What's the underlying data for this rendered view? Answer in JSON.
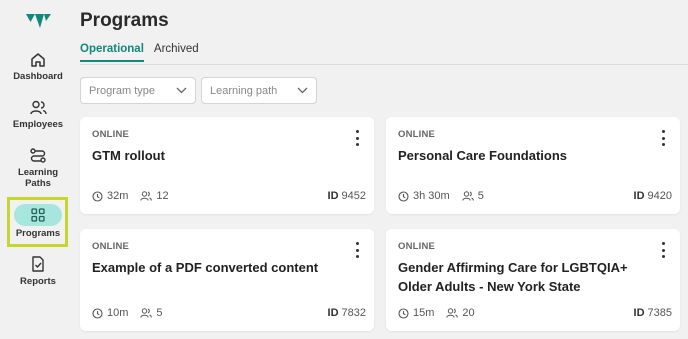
{
  "sidebar": {
    "items": [
      {
        "label": "Dashboard",
        "icon": "home-icon"
      },
      {
        "label": "Employees",
        "icon": "people-icon"
      },
      {
        "label": "Learning Paths",
        "icon": "route-icon"
      },
      {
        "label": "Programs",
        "icon": "grid-icon",
        "active": true
      },
      {
        "label": "Reports",
        "icon": "report-icon"
      }
    ]
  },
  "header": {
    "title": "Programs"
  },
  "tabs": [
    {
      "label": "Operational",
      "active": true
    },
    {
      "label": "Archived",
      "active": false
    }
  ],
  "filters": {
    "program_type": "Program type",
    "learning_path": "Learning path"
  },
  "programs": [
    {
      "mode": "ONLINE",
      "name": "GTM rollout",
      "duration": "32m",
      "enrolled": "12",
      "id_label": "ID",
      "id": "9452"
    },
    {
      "mode": "ONLINE",
      "name": "Personal Care Foundations",
      "duration": "3h 30m",
      "enrolled": "5",
      "id_label": "ID",
      "id": "9420"
    },
    {
      "mode": "ONLINE",
      "name": "Example of a PDF converted content",
      "duration": "10m",
      "enrolled": "5",
      "id_label": "ID",
      "id": "7832"
    },
    {
      "mode": "ONLINE",
      "name": "Gender Affirming Care for LGBTQIA+ Older Adults - New York State",
      "duration": "15m",
      "enrolled": "20",
      "id_label": "ID",
      "id": "7385"
    }
  ],
  "colors": {
    "accent": "#12877a",
    "active_pill": "#a6e6dc",
    "highlight_border": "#c6d62e",
    "background": "#f1f1f1"
  }
}
